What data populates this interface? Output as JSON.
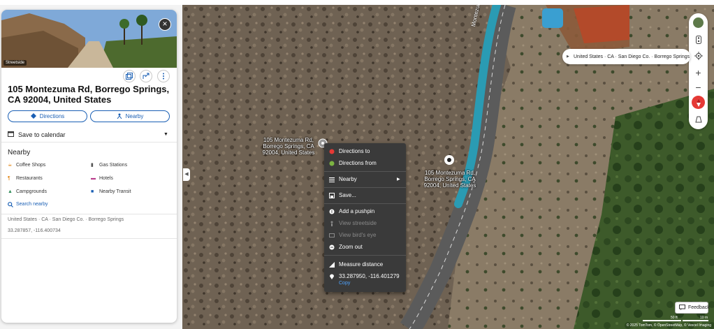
{
  "panel": {
    "streetside_label": "Streetside",
    "title": "105 Montezuma Rd, Borrego Springs, CA 92004, United States",
    "directions_label": "Directions",
    "nearby_button_label": "Nearby",
    "save_calendar_label": "Save to calendar",
    "nearby_header": "Nearby",
    "nearby_items": [
      {
        "label": "Coffee Shops",
        "icon": "coffee-icon"
      },
      {
        "label": "Gas Stations",
        "icon": "gas-station-icon"
      },
      {
        "label": "Restaurants",
        "icon": "restaurant-icon"
      },
      {
        "label": "Hotels",
        "icon": "hotel-icon"
      },
      {
        "label": "Campgrounds",
        "icon": "campground-icon"
      },
      {
        "label": "Nearby Transit",
        "icon": "transit-icon"
      }
    ],
    "search_nearby_label": "Search nearby",
    "breadcrumb": "United States · CA · San Diego Co. · Borrego Springs",
    "coordinates": "33.287857, -116.400734"
  },
  "map": {
    "road_name": "Montezuma Ct",
    "pin_label_left": "105 Montezuma Rd, Borrego Springs, CA 92004, United States",
    "pin_label_right": "105 Montezuma Rd, Borrego Springs, CA 92004, United States",
    "breadcrumb_bar": "United States · CA · San Diego Co. · Borrego Springs",
    "feedback_label": "Feedback",
    "scale_labels": [
      "50 ft",
      "10 m"
    ],
    "copyright": "© 2025 TomTom, © OpenStreetMap, © Vexcel Imaging"
  },
  "context_menu": {
    "items": [
      {
        "label": "Directions to",
        "icon": "red-dot-icon",
        "enabled": true
      },
      {
        "label": "Directions from",
        "icon": "green-dot-icon",
        "enabled": true
      },
      {
        "label": "Nearby",
        "icon": "nearby-icon",
        "enabled": true
      },
      {
        "label": "Save...",
        "icon": "save-icon",
        "enabled": true
      },
      {
        "label": "Add a pushpin",
        "icon": "pushpin-icon",
        "enabled": true
      },
      {
        "label": "View streetside",
        "icon": "streetside-icon",
        "enabled": false
      },
      {
        "label": "View bird's eye",
        "icon": "birdseye-icon",
        "enabled": false
      },
      {
        "label": "Zoom out",
        "icon": "zoom-out-icon",
        "enabled": true
      },
      {
        "label": "Measure distance",
        "icon": "ruler-icon",
        "enabled": true
      },
      {
        "label": "33.287950, -116.401279",
        "icon": "location-icon",
        "enabled": true
      }
    ],
    "copy_label": "Copy"
  },
  "colors": {
    "accent": "#1a5fb4",
    "menu_bg": "#3a3a3a",
    "road_highlight": "#2a9bb3"
  }
}
